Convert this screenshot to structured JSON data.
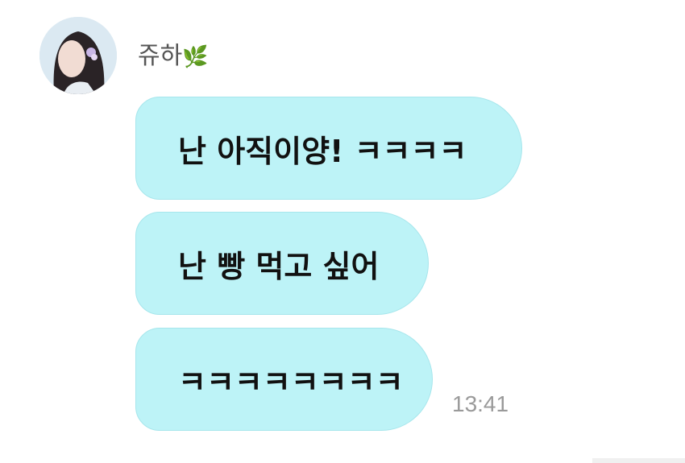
{
  "chat": {
    "sender": {
      "name": "쥬하",
      "name_emoji": "🌿"
    },
    "messages": [
      {
        "text": "난 아직이양! ㅋㅋㅋㅋ"
      },
      {
        "text": "난 빵 먹고 싶어"
      },
      {
        "text": "ㅋㅋㅋㅋㅋㅋㅋㅋ"
      }
    ],
    "timestamp": "13:41"
  },
  "colors": {
    "bubble_background": "#bdf3f7",
    "bubble_border": "#a6e6ec",
    "text": "#111111",
    "timestamp": "#9a9a9a",
    "sender_name": "#555555"
  },
  "icons": {
    "name_decoration": "herb-icon"
  }
}
